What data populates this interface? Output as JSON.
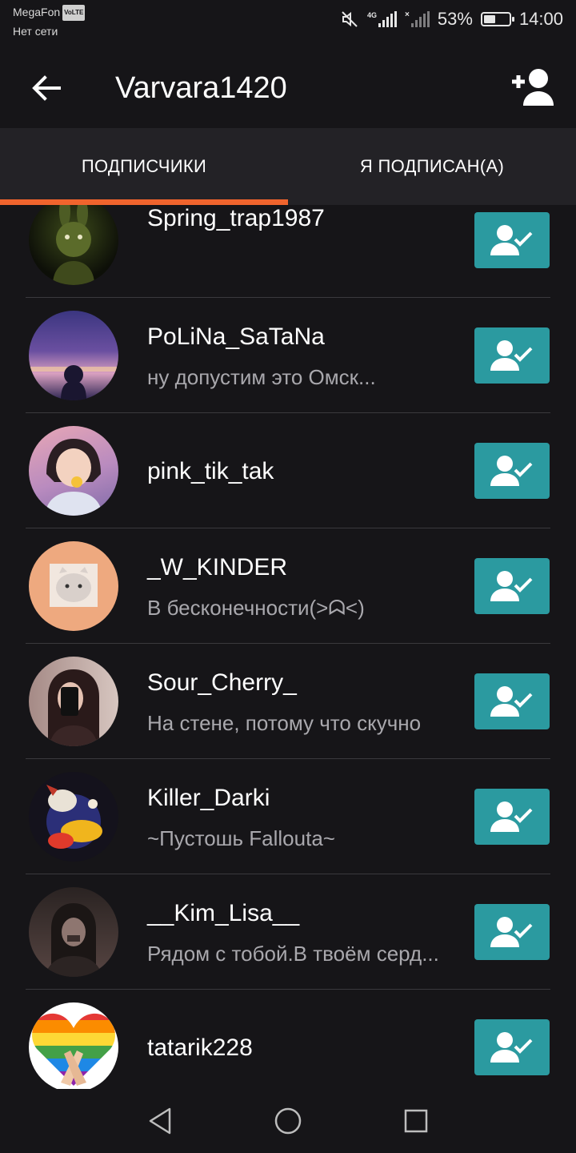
{
  "status_bar": {
    "carrier": "MegaFon",
    "volte": "VoLTE",
    "network_status": "Нет сети",
    "battery_percent": "53%",
    "battery_level": 0.53,
    "time": "14:00",
    "icons": [
      "mute-icon",
      "signal-4g-icon",
      "signal-x-icon",
      "battery-icon"
    ]
  },
  "header": {
    "title": "Varvara1420",
    "back_icon": "arrow-left-icon",
    "add_icon": "add-user-icon"
  },
  "tabs": [
    {
      "label": "ПОДПИСЧИКИ",
      "active": true
    },
    {
      "label": "Я ПОДПИСАН(А)",
      "active": false
    }
  ],
  "users": [
    {
      "name": "Spring_trap1987",
      "status": ""
    },
    {
      "name": "PoLiNa_SaTaNa",
      "status": "ну допустим это Омск..."
    },
    {
      "name": "pink_tik_tak",
      "status": ""
    },
    {
      "name": "_W_KINDER",
      "status": "В бесконечности(>ᗣ<)"
    },
    {
      "name": "Sour_Cherry_",
      "status": "На стене, потому что скучно"
    },
    {
      "name": "Killer_Darki",
      "status": "~Пустошь Fallouta~"
    },
    {
      "name": "__Kim_Lisa__",
      "status": "Рядом с тобой.В твоём серд..."
    },
    {
      "name": "tatarik228",
      "status": ""
    }
  ],
  "colors": {
    "background": "#161518",
    "tab_bar": "#232226",
    "accent": "#f0642d",
    "follow_button": "#2b9aa0",
    "secondary_text": "#a9a8ad"
  },
  "navigation": [
    "back-triangle-icon",
    "home-circle-icon",
    "recents-square-icon"
  ]
}
